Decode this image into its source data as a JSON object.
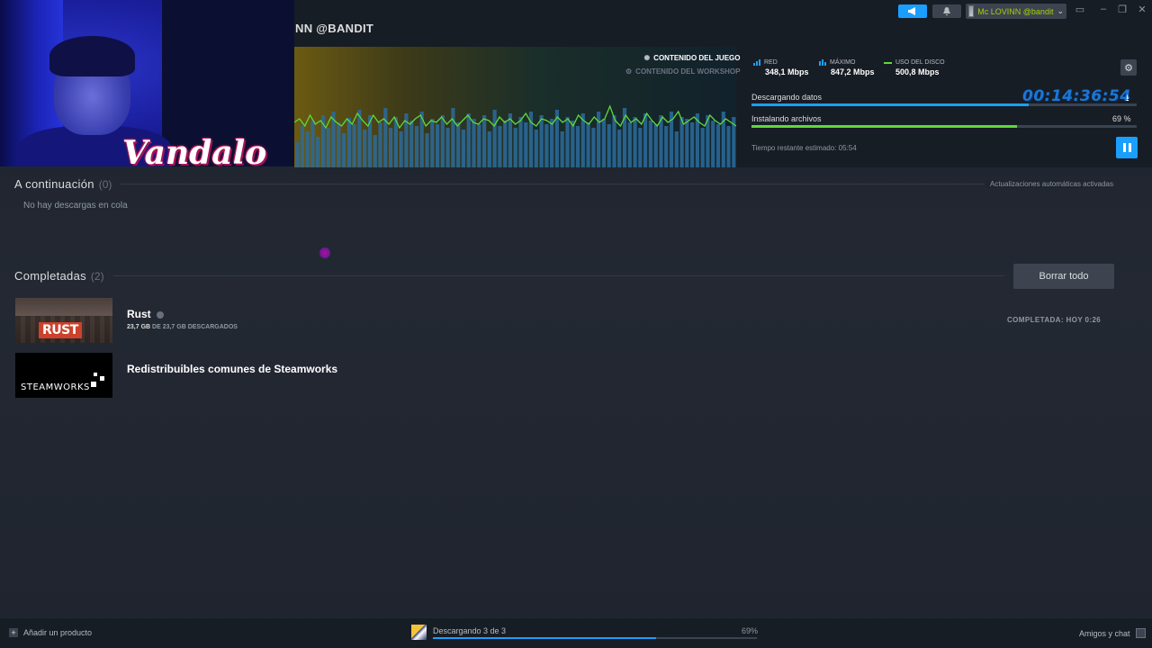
{
  "header": {
    "title": "NN @BANDIT",
    "user_name": "Mc LOVINN @bandit",
    "user_chevron": "⌄"
  },
  "webcam": {
    "watermark": "Vandalo"
  },
  "content_tabs": {
    "game": "CONTENIDO DEL JUEGO",
    "workshop": "CONTENIDO DEL WORKSHOP"
  },
  "stats": {
    "network": {
      "label": "RED",
      "value": "348,1 Mbps"
    },
    "peak": {
      "label": "MÁXIMO",
      "value": "847,2 Mbps"
    },
    "disk": {
      "label": "USO DEL DISCO",
      "value": "500,8 Mbps"
    }
  },
  "progress": {
    "downloading_label": "Descargando datos",
    "downloading_fraction": 0.72,
    "installing_label": "Instalando archivos",
    "installing_percent": "69 %",
    "installing_fraction": 0.69,
    "time_remaining": "Tiempo restante estimado: 05:54",
    "timer_overlay": "00:14:36:54"
  },
  "queue": {
    "title": "A continuación",
    "count": "(0)",
    "auto_updates": "Actualizaciones automáticas activadas",
    "empty_message": "No hay descargas en cola"
  },
  "completed": {
    "title": "Completadas",
    "count": "(2)",
    "clear_all": "Borrar todo",
    "items": [
      {
        "name": "Rust",
        "size_done": "23,7 GB",
        "size_sep": " DE 23,7 GB DESCARGADOS",
        "status": "COMPLETADA: HOY 0:26",
        "logo_text": "RUST"
      },
      {
        "name": "Redistribuibles comunes de Steamworks",
        "logo_text": "STEAMWORKS"
      }
    ]
  },
  "footer": {
    "add_product": "Añadir un producto",
    "downloading_status": "Descargando 3 de 3",
    "percent": "69%",
    "fraction": 0.69,
    "friends_chat": "Amigos y chat"
  },
  "colors": {
    "accent_blue": "#1a9fff",
    "disk_green": "#5ed83b",
    "username_green": "#a4d007"
  },
  "graph": {
    "network_bars": [
      28,
      46,
      40,
      52,
      34,
      58,
      44,
      62,
      50,
      38,
      55,
      48,
      64,
      42,
      58,
      36,
      50,
      66,
      44,
      56,
      40,
      60,
      52,
      46,
      62,
      38,
      54,
      48,
      58,
      44,
      66,
      50,
      42,
      60,
      54,
      48,
      58,
      40,
      64,
      46,
      52,
      60,
      44,
      56,
      50,
      62,
      42,
      58,
      48,
      54,
      64,
      40,
      56,
      52,
      46,
      60,
      50,
      44,
      62,
      54,
      48,
      58,
      42,
      66,
      50,
      56,
      44,
      60,
      52,
      48,
      58,
      46,
      62,
      40,
      56,
      54,
      50,
      60,
      44,
      58,
      52,
      48,
      62,
      46,
      56
    ],
    "disk_line": [
      40,
      44,
      36,
      48,
      38,
      42,
      34,
      46,
      40,
      36,
      44,
      38,
      50,
      42,
      36,
      48,
      40,
      44,
      38,
      46,
      34,
      42,
      38,
      44,
      48,
      36,
      42,
      40,
      46,
      38,
      44,
      36,
      42,
      48,
      40,
      38,
      44,
      42,
      36,
      46,
      40,
      44,
      38,
      42,
      50,
      40,
      36,
      44,
      42,
      38,
      46,
      40,
      44,
      36,
      48,
      42,
      38,
      46,
      40,
      44,
      58,
      42,
      36,
      48,
      40,
      44,
      38,
      50,
      42,
      36,
      46,
      40,
      44,
      52,
      38,
      42,
      46,
      40,
      36,
      48,
      42,
      38,
      44,
      40,
      36
    ]
  }
}
